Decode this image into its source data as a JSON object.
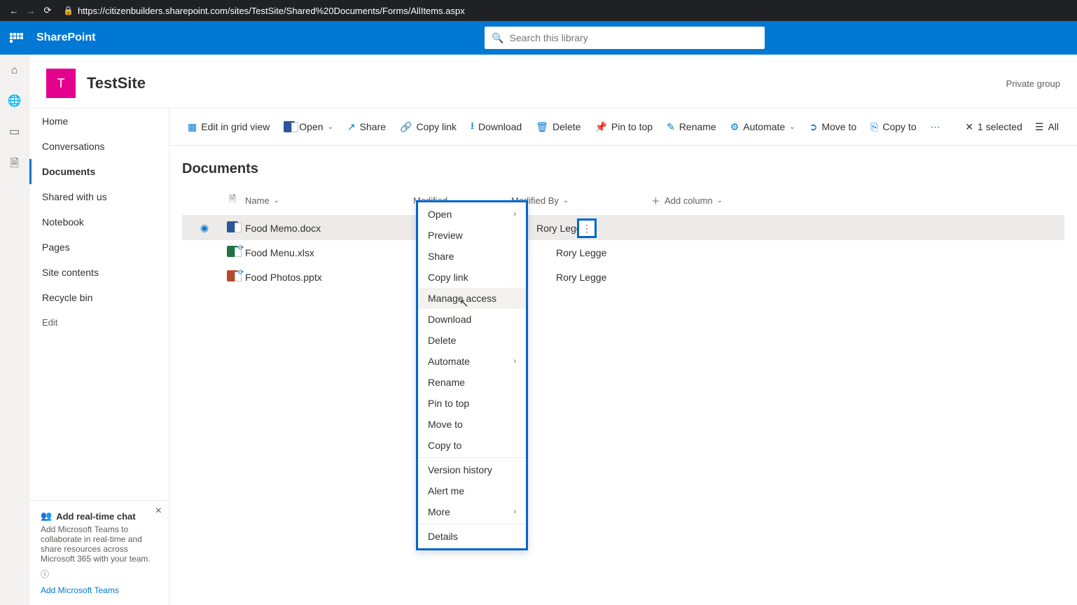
{
  "browser": {
    "url": "https://citizenbuilders.sharepoint.com/sites/TestSite/Shared%20Documents/Forms/AllItems.aspx"
  },
  "header": {
    "brand": "SharePoint",
    "search_placeholder": "Search this library"
  },
  "site": {
    "initial": "T",
    "title": "TestSite",
    "meta": "Private group"
  },
  "nav": {
    "items": [
      "Home",
      "Conversations",
      "Documents",
      "Shared with us",
      "Notebook",
      "Pages",
      "Site contents",
      "Recycle bin"
    ],
    "edit": "Edit"
  },
  "teams": {
    "title": "Add real-time chat",
    "body": "Add Microsoft Teams to collaborate in real-time and share resources across Microsoft 365 with your team.",
    "link": "Add Microsoft Teams"
  },
  "cmd": {
    "edit_grid": "Edit in grid view",
    "open": "Open",
    "share": "Share",
    "copy_link": "Copy link",
    "download": "Download",
    "delete": "Delete",
    "pin": "Pin to top",
    "rename": "Rename",
    "automate": "Automate",
    "move": "Move to",
    "copy": "Copy to",
    "selected": "1 selected",
    "all": "All"
  },
  "docs": {
    "title": "Documents",
    "cols": {
      "name": "Name",
      "modified": "Modified",
      "by": "Modified By",
      "add": "Add column"
    },
    "rows": [
      {
        "name": "Food Memo.docx",
        "type": "w",
        "by": "Rory Legge",
        "selected": true,
        "sync": false
      },
      {
        "name": "Food Menu.xlsx",
        "type": "x",
        "by": "Rory Legge",
        "selected": false,
        "sync": true
      },
      {
        "name": "Food Photos.pptx",
        "type": "p",
        "by": "Rory Legge",
        "selected": false,
        "sync": true
      }
    ]
  },
  "ctx": {
    "open": "Open",
    "preview": "Preview",
    "share": "Share",
    "copylink": "Copy link",
    "manage": "Manage access",
    "download": "Download",
    "delete": "Delete",
    "automate": "Automate",
    "rename": "Rename",
    "pin": "Pin to top",
    "move": "Move to",
    "copy": "Copy to",
    "version": "Version history",
    "alert": "Alert me",
    "more": "More",
    "details": "Details"
  }
}
